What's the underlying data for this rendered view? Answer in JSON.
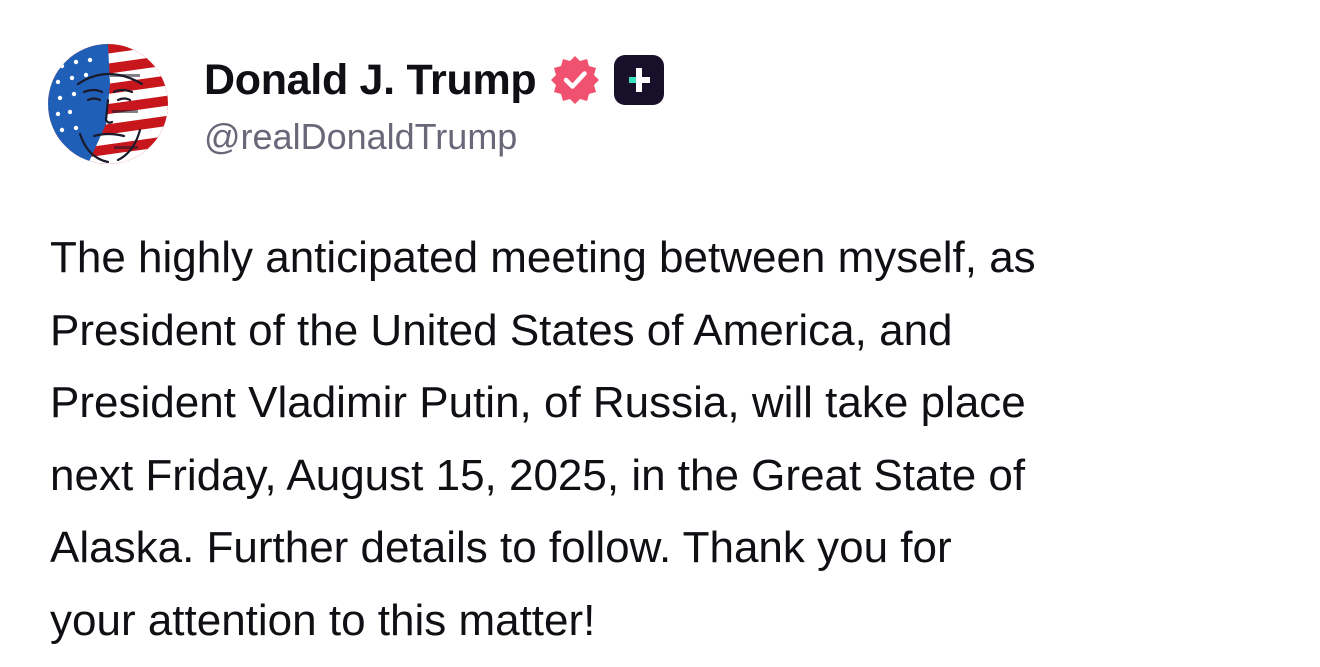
{
  "author": {
    "display_name": "Donald J. Trump",
    "handle": "@realDonaldTrump",
    "verified_icon": "verified-badge-icon",
    "verified_color": "#f0516f",
    "plus_icon": "truth-plus-icon",
    "plus_bg": "#18102b",
    "plus_accent": "#33e0c0"
  },
  "post": {
    "lines": [
      "The highly anticipated meeting between myself, as",
      "President of the United States of America, and",
      "President Vladimir Putin, of Russia, will take place",
      "next Friday, August 15, 2025, in the Great State of",
      "Alaska. Further details to follow. Thank you for",
      "your attention to this matter!"
    ]
  }
}
